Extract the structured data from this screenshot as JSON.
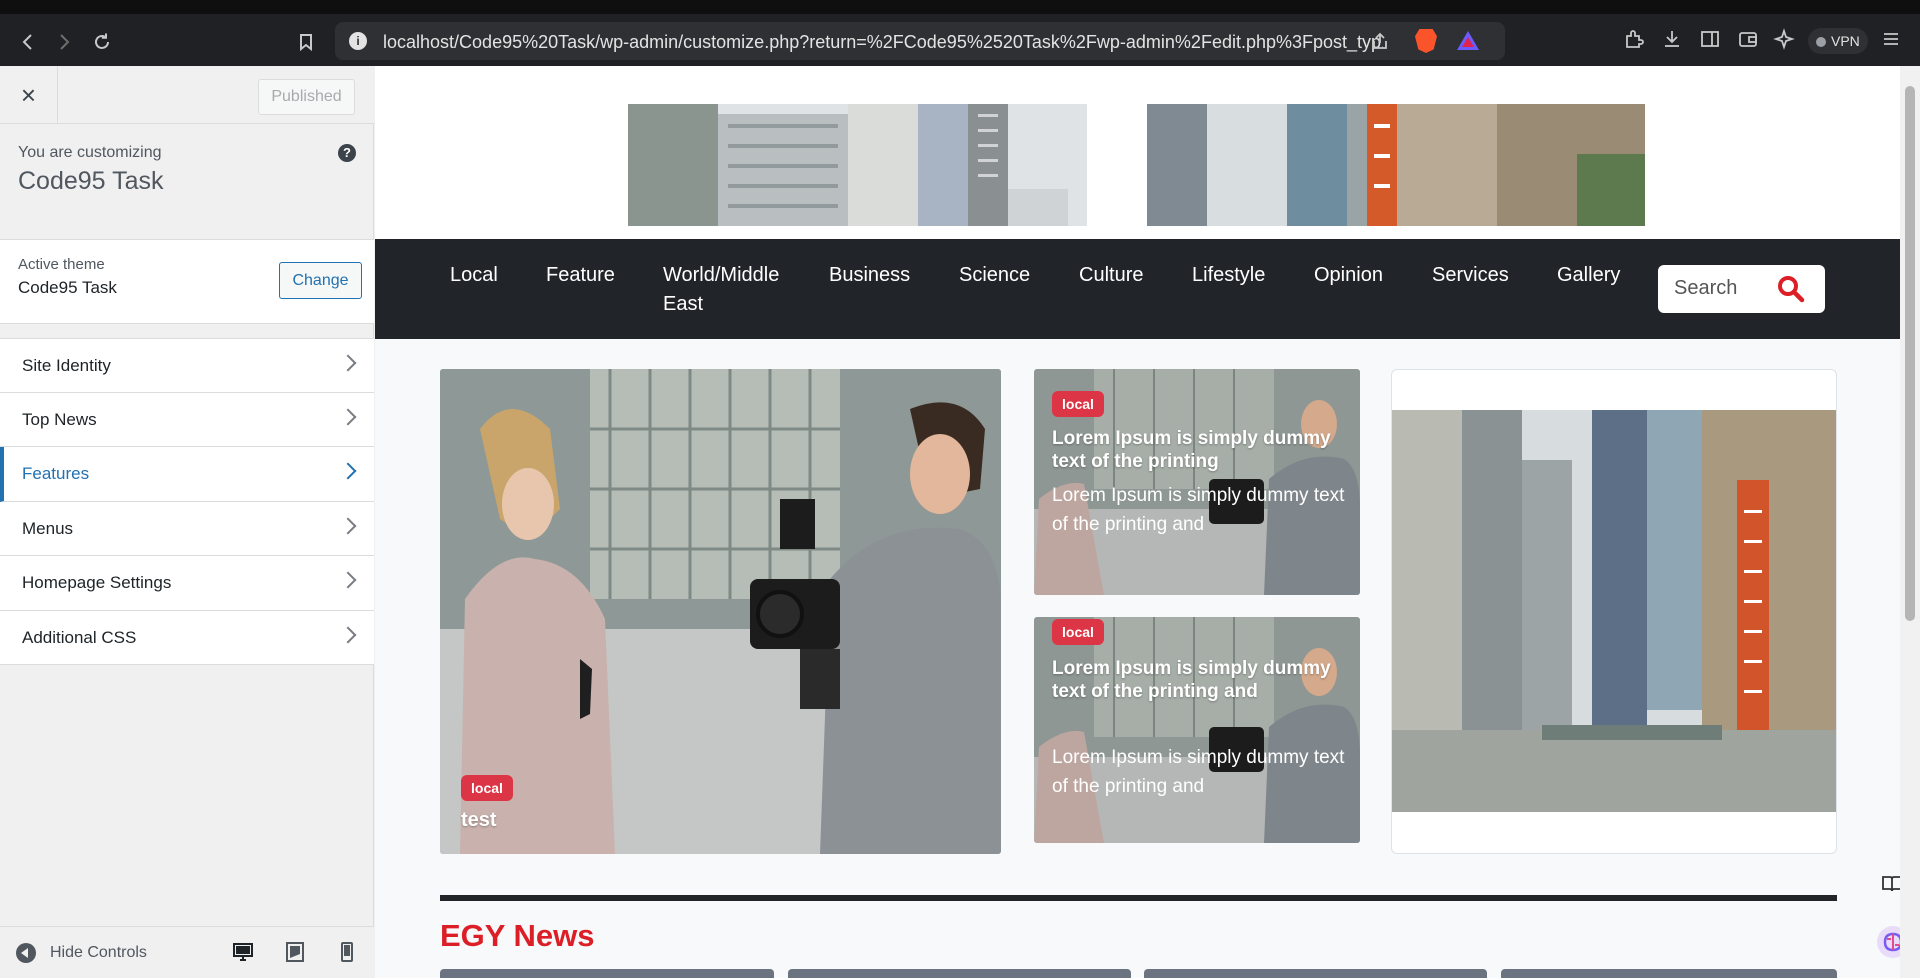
{
  "browser": {
    "url": "localhost/Code95%20Task/wp-admin/customize.php?return=%2FCode95%2520Task%2Fwp-admin%2Fedit.php%3Fpost_typ...",
    "vpn_label": "VPN",
    "icons": [
      "back-icon",
      "forward-icon",
      "reload-icon",
      "bookmark-icon",
      "info-icon",
      "share-icon",
      "brave-icon",
      "rewards-icon",
      "extensions-icon",
      "download-icon",
      "sidebar-icon",
      "wallet-icon",
      "leo-ai-icon",
      "menu-icon"
    ]
  },
  "customizer": {
    "close_label": "×",
    "published_label": "Published",
    "customizing_label": "You are customizing",
    "site_title": "Code95 Task",
    "help_label": "?",
    "active_theme_label": "Active theme",
    "active_theme_name": "Code95 Task",
    "change_label": "Change",
    "sections": [
      {
        "label": "Site Identity",
        "active": false
      },
      {
        "label": "Top News",
        "active": false
      },
      {
        "label": "Features",
        "active": true
      },
      {
        "label": "Menus",
        "active": false
      },
      {
        "label": "Homepage Settings",
        "active": false
      },
      {
        "label": "Additional CSS",
        "active": false
      }
    ],
    "hide_controls_label": "Hide Controls",
    "devices": [
      "desktop-icon",
      "tablet-icon",
      "mobile-icon"
    ]
  },
  "site": {
    "nav": [
      "Local",
      "Feature",
      "World/Middle East",
      "Business",
      "Science",
      "Culture",
      "Lifestyle",
      "Opinion",
      "Services",
      "Gallery"
    ],
    "search_placeholder": "Search",
    "hero": {
      "badge": "local",
      "title": "test"
    },
    "cards": [
      {
        "badge": "local",
        "title": "Lorem Ipsum is simply dummy text of the printing",
        "excerpt": "Lorem Ipsum is simply dummy text of the printing and"
      },
      {
        "badge": "local",
        "title": "Lorem Ipsum is simply dummy text of the printing and",
        "excerpt": "Lorem Ipsum is simply dummy text of the printing and"
      }
    ],
    "section_title": "EGY News"
  },
  "colors": {
    "accent": "#2271b1",
    "badge": "#dc3545",
    "nav_bg": "#212529",
    "section_title": "#dc1f26"
  }
}
